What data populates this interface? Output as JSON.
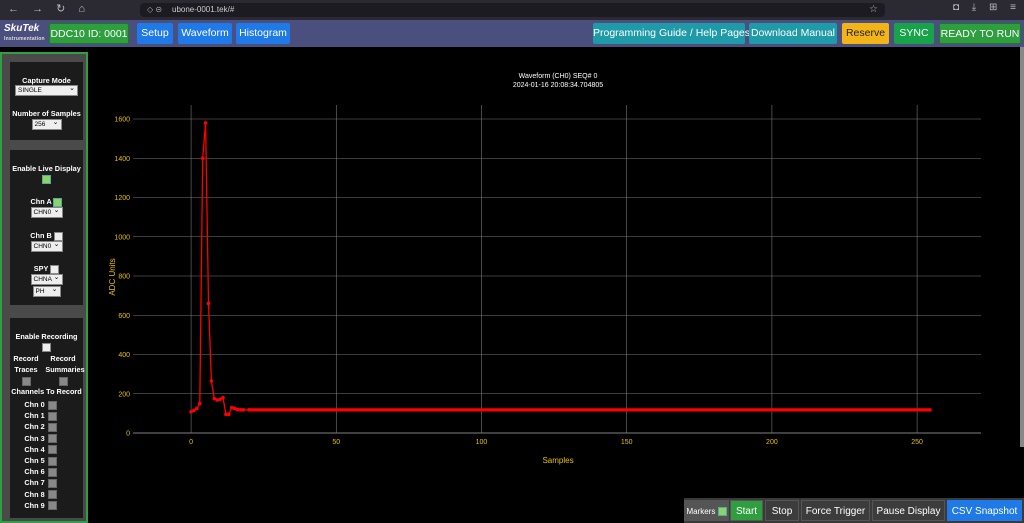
{
  "browser": {
    "url": "ubone-0001.tek/#"
  },
  "header": {
    "logo_main": "SkuTek",
    "logo_sub": "Instrumentation",
    "device_id": "DDC10 ID: 0001",
    "nav": [
      "Setup",
      "Waveform",
      "Histogram"
    ],
    "right_buttons": [
      "Programming Guide / Help Pages",
      "Download Manual",
      "Reserve",
      "SYNC",
      "READY TO RUN"
    ]
  },
  "sidebar": {
    "capture_mode_label": "Capture Mode",
    "capture_mode_value": "SINGLE",
    "num_samples_label": "Number of Samples",
    "num_samples_value": "256",
    "live_display_label": "Enable Live Display",
    "chn_a_label": "Chn A",
    "chn_a_value": "CHN0",
    "chn_b_label": "Chn B",
    "chn_b_value": "CHN0",
    "spy_label": "SPY",
    "spy_value1": "CHNA",
    "spy_value2": "PH",
    "recording_label": "Enable Recording",
    "record_traces_label1": "Record",
    "record_traces_label2": "Traces",
    "record_summaries_label1": "Record",
    "record_summaries_label2": "Summaries",
    "channels_label": "Channels To Record",
    "channels": [
      "Chn 0",
      "Chn 1",
      "Chn 2",
      "Chn 3",
      "Chn 4",
      "Chn 5",
      "Chn 6",
      "Chn 7",
      "Chn 8",
      "Chn 9"
    ]
  },
  "chart_data": {
    "type": "line",
    "title": "Waveform (CH0) SEQ# 0",
    "subtitle": "2024-01-16 20:08:34.704805",
    "xlabel": "Samples",
    "ylabel": "ADC Units",
    "xlim": [
      -20,
      272
    ],
    "ylim": [
      0,
      1600
    ],
    "xticks": [
      0,
      50,
      100,
      150,
      200,
      250
    ],
    "yticks": [
      0,
      200,
      400,
      600,
      800,
      1000,
      1200,
      1400,
      1600
    ],
    "grid": true,
    "color": "#ff0000",
    "x": [
      0,
      1,
      2,
      3,
      4,
      5,
      6,
      7,
      8,
      9,
      10,
      11,
      12,
      13,
      14,
      15,
      16,
      17,
      18,
      20,
      25,
      30,
      50,
      100,
      150,
      200,
      255
    ],
    "y": [
      108,
      115,
      125,
      150,
      1400,
      1580,
      660,
      265,
      175,
      168,
      172,
      180,
      95,
      95,
      130,
      125,
      120,
      118,
      118,
      118,
      118,
      118,
      118,
      118,
      118,
      118,
      118
    ]
  },
  "bottom": {
    "markers_label": "Markers",
    "buttons": [
      "Start",
      "Stop",
      "Force Trigger",
      "Pause Display",
      "CSV Snapshot"
    ]
  }
}
